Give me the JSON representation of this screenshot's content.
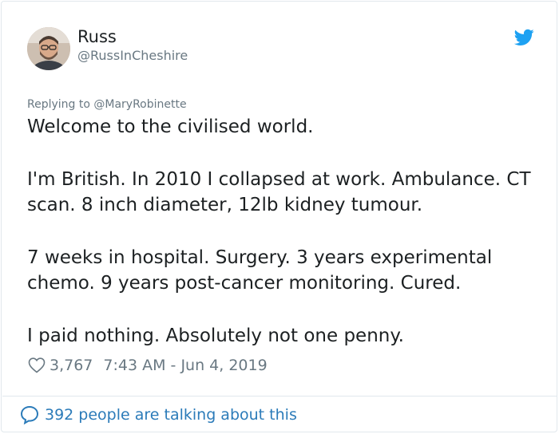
{
  "tweet": {
    "author": {
      "name": "Russ",
      "handle": "@RussInCheshire",
      "avatar_icon": "user-avatar-photo"
    },
    "platform_icon": "twitter-bird-icon",
    "brand_color": "#1da1f2",
    "replying_to": "Replying to @MaryRobinette",
    "paragraphs": [
      "Welcome to the civilised world.",
      "I'm British. In 2010 I collapsed at work. Ambulance. CT scan. 8 inch diameter, 12lb kidney tumour.",
      "7 weeks in hospital. Surgery. 3 years experimental chemo. 9 years post-cancer monitoring. Cured.",
      "I paid nothing. Absolutely not one penny."
    ],
    "likes": "3,767",
    "timestamp": "7:43 AM - Jun 4, 2019",
    "talking": "392 people are talking about this",
    "link_color": "#2b7bb9"
  }
}
